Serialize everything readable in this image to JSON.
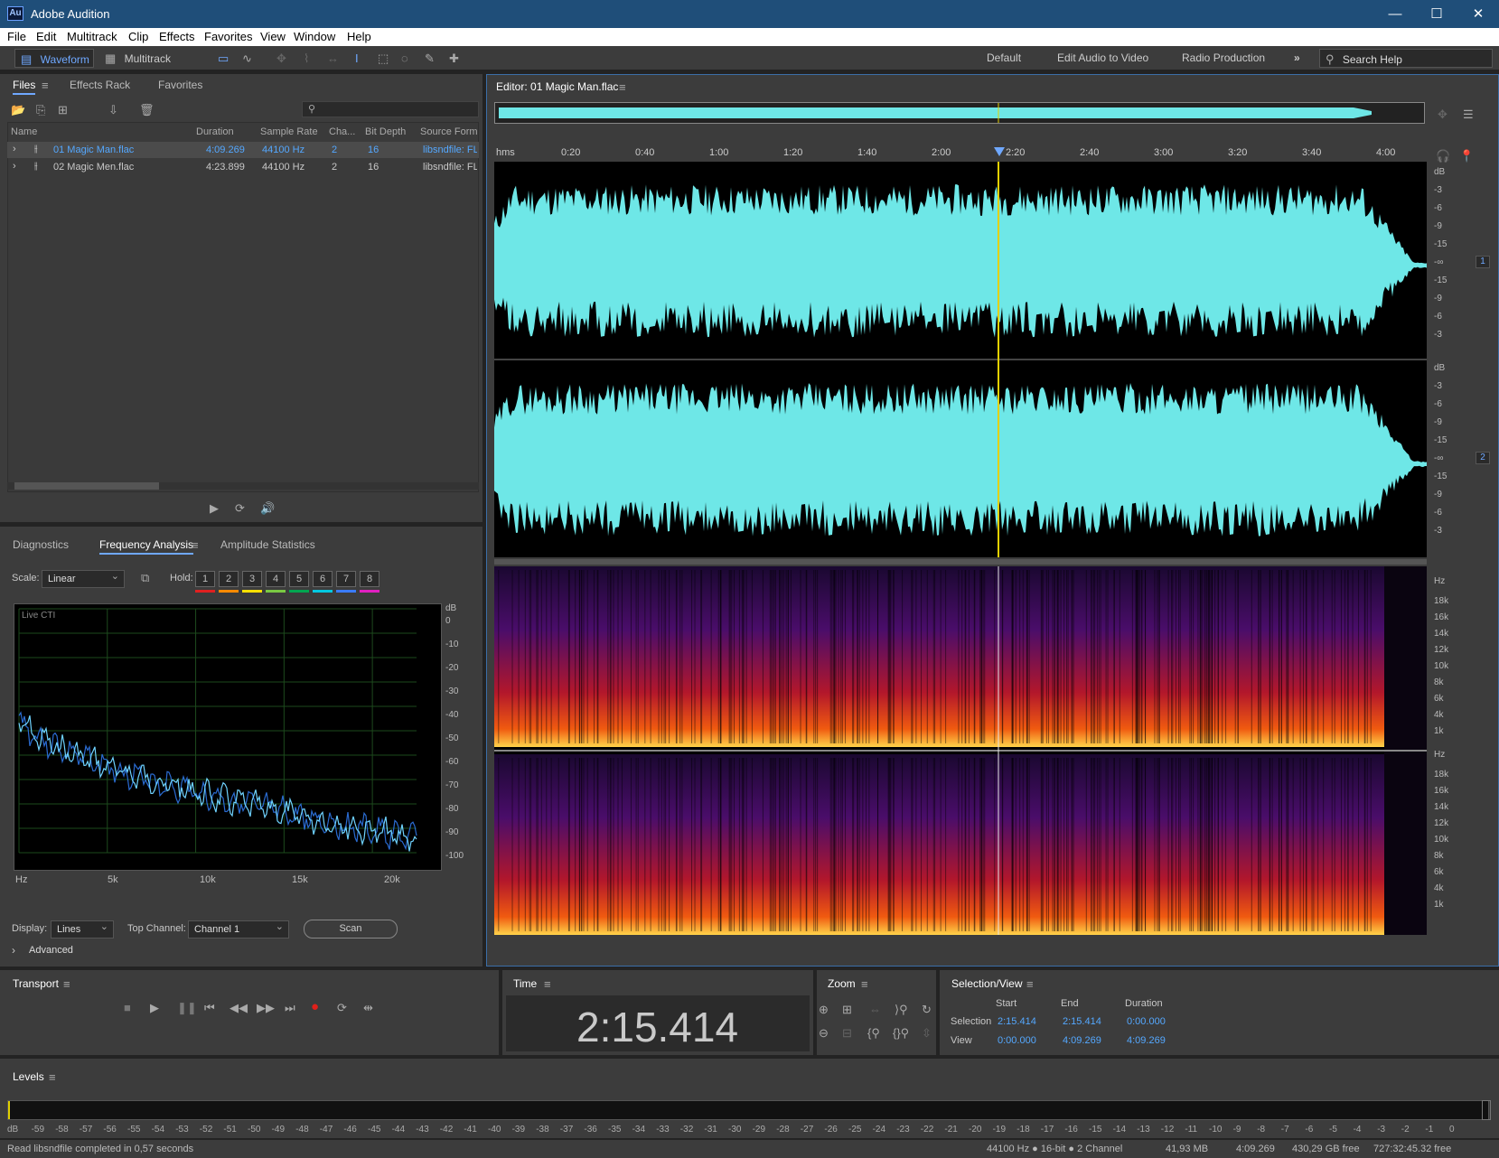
{
  "app": {
    "title": "Adobe Audition",
    "logo": "Au"
  },
  "menu": [
    "File",
    "Edit",
    "Multitrack",
    "Clip",
    "Effects",
    "Favorites",
    "View",
    "Window",
    "Help"
  ],
  "toolbar": {
    "waveform": "Waveform",
    "multitrack": "Multitrack",
    "workspaces": [
      "Default",
      "Edit Audio to Video",
      "Radio Production"
    ],
    "search_placeholder": "Search Help"
  },
  "files_panel": {
    "tabs": [
      "Files",
      "Effects Rack",
      "Favorites"
    ],
    "columns": [
      "Name",
      "Duration",
      "Sample Rate",
      "Cha...",
      "Bit Depth",
      "Source Forma"
    ],
    "rows": [
      {
        "name": "01 Magic Man.flac",
        "duration": "4:09.269",
        "rate": "44100 Hz",
        "ch": "2",
        "bits": "16",
        "src": "libsndfile: FL",
        "selected": true
      },
      {
        "name": "02 Magic Men.flac",
        "duration": "4:23.899",
        "rate": "44100 Hz",
        "ch": "2",
        "bits": "16",
        "src": "libsndfile: FL",
        "selected": false
      }
    ]
  },
  "analysis_panel": {
    "tabs": [
      "Diagnostics",
      "Frequency Analysis",
      "Amplitude Statistics"
    ],
    "scale_label": "Scale:",
    "scale_value": "Linear",
    "hold_label": "Hold:",
    "hold": [
      "1",
      "2",
      "3",
      "4",
      "5",
      "6",
      "7",
      "8"
    ],
    "hold_colors": [
      "#e02020",
      "#ff8a00",
      "#ffe000",
      "#7ac943",
      "#00a650",
      "#00c8e0",
      "#3a7bff",
      "#e020c0"
    ],
    "live_cti": "Live CTI",
    "db_label": "dB",
    "db_ticks": [
      "0",
      "-10",
      "-20",
      "-30",
      "-40",
      "-50",
      "-60",
      "-70",
      "-80",
      "-90",
      "-100"
    ],
    "hz_ticks": [
      "Hz",
      "5k",
      "10k",
      "15k",
      "20k"
    ],
    "display_label": "Display:",
    "display_value": "Lines",
    "top_channel_label": "Top Channel:",
    "top_channel_value": "Channel 1",
    "scan": "Scan",
    "advanced": "Advanced"
  },
  "editor": {
    "title": "Editor: 01 Magic Man.flac",
    "ruler": [
      "hms",
      "0:20",
      "0:40",
      "1:00",
      "1:20",
      "1:40",
      "2:00",
      "2:20",
      "2:40",
      "3:00",
      "3:20",
      "3:40",
      "4:00"
    ],
    "db_label": "dB",
    "db_scale": [
      "-3",
      "-6",
      "-9",
      "-15",
      "-∞",
      "-15",
      "-9",
      "-6",
      "-3"
    ],
    "channels": [
      "1",
      "2"
    ],
    "hz_label": "Hz",
    "hz_scale": [
      "18k",
      "16k",
      "14k",
      "12k",
      "10k",
      "8k",
      "6k",
      "4k",
      "1k"
    ]
  },
  "transport": {
    "title": "Transport"
  },
  "time": {
    "title": "Time",
    "value": "2:15.414"
  },
  "zoom": {
    "title": "Zoom"
  },
  "selection_view": {
    "title": "Selection/View",
    "cols": [
      "Start",
      "End",
      "Duration"
    ],
    "selection_label": "Selection",
    "selection": [
      "2:15.414",
      "2:15.414",
      "0:00.000"
    ],
    "view_label": "View",
    "view": [
      "0:00.000",
      "4:09.269",
      "4:09.269"
    ]
  },
  "levels": {
    "title": "Levels",
    "scale": [
      "dB",
      "-59",
      "-58",
      "-57",
      "-56",
      "-55",
      "-54",
      "-53",
      "-52",
      "-51",
      "-50",
      "-49",
      "-48",
      "-47",
      "-46",
      "-45",
      "-44",
      "-43",
      "-42",
      "-41",
      "-40",
      "-39",
      "-38",
      "-37",
      "-36",
      "-35",
      "-34",
      "-33",
      "-32",
      "-31",
      "-30",
      "-29",
      "-28",
      "-27",
      "-26",
      "-25",
      "-24",
      "-23",
      "-22",
      "-21",
      "-20",
      "-19",
      "-18",
      "-17",
      "-16",
      "-15",
      "-14",
      "-13",
      "-12",
      "-11",
      "-10",
      "-9",
      "-8",
      "-7",
      "-6",
      "-5",
      "-4",
      "-3",
      "-2",
      "-1",
      "0"
    ]
  },
  "status": {
    "message": "Read libsndfile completed in 0,57 seconds",
    "format": "44100 Hz ● 16-bit ● 2 Channel",
    "size": "41,93 MB",
    "duration": "4:09.269",
    "free": "430,29 GB free",
    "free_time": "727:32:45.32 free"
  }
}
